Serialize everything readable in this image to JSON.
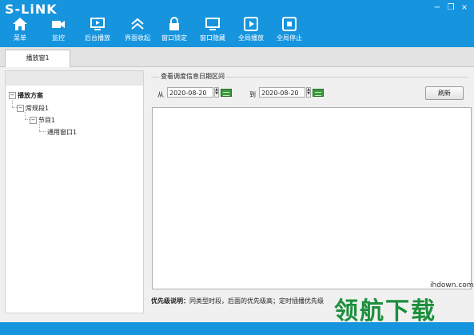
{
  "app": {
    "logo_text": "S-LiNK",
    "accent_color": "#1694dd"
  },
  "window_controls": {
    "minimize": "−",
    "restore": "❐",
    "close": "×"
  },
  "toolbar": [
    {
      "label": "菜单",
      "icon": "home-icon"
    },
    {
      "label": "监控",
      "icon": "camera-icon"
    },
    {
      "label": "后台播放",
      "icon": "monitor-play-icon"
    },
    {
      "label": "界面收起",
      "icon": "collapse-up-icon"
    },
    {
      "label": "窗口锁定",
      "icon": "lock-icon"
    },
    {
      "label": "窗口隐藏",
      "icon": "monitor-icon"
    },
    {
      "label": "全局播放",
      "icon": "play-icon"
    },
    {
      "label": "全局停止",
      "icon": "stop-icon"
    }
  ],
  "tabs": [
    {
      "label": "播放窗1",
      "active": true
    }
  ],
  "tree": {
    "root": "播放方案",
    "level1": "常规段1",
    "level2": "节目1",
    "level3": "通用窗口1"
  },
  "query": {
    "group_title": "查看调度信息日期区间",
    "from_label": "从",
    "from_value": "2020-08-20",
    "to_label": "到",
    "to_value": "2020-08-20",
    "refresh_label": "刷新"
  },
  "note": {
    "title": "优先级说明：",
    "text": "同类型时段，后面的优先级高；定时插播优先级"
  },
  "watermark": {
    "site": "ihdown.com",
    "brand": "领航下载"
  }
}
